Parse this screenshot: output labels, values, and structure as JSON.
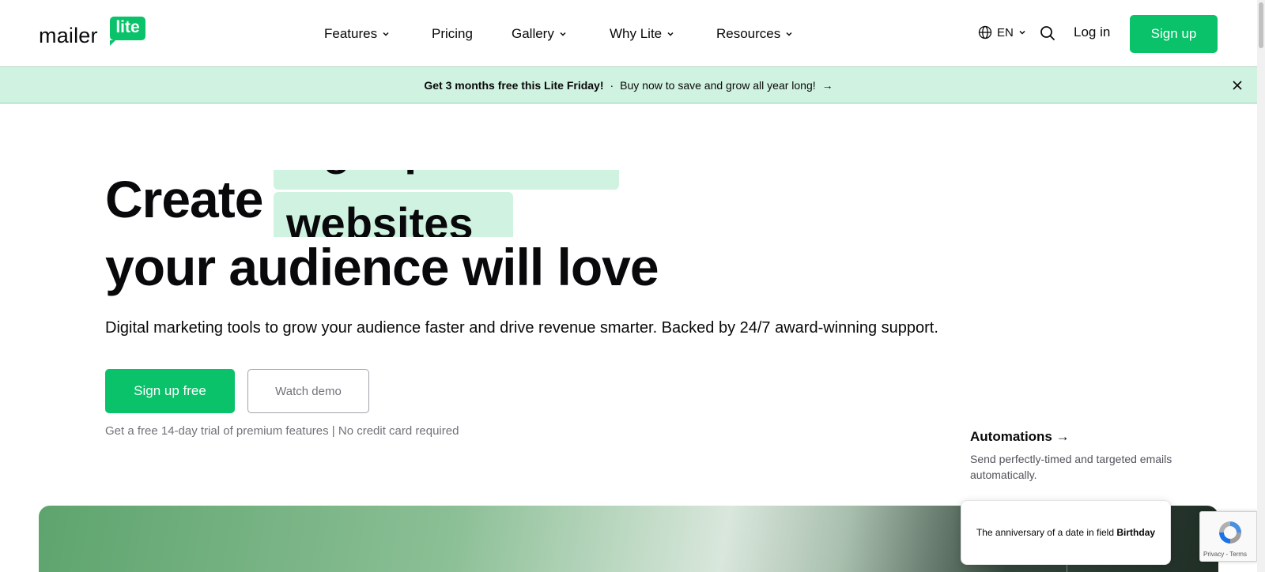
{
  "header": {
    "logo_text": "mailer",
    "logo_badge": "lite",
    "nav": [
      {
        "label": "Features",
        "has_dropdown": true
      },
      {
        "label": "Pricing",
        "has_dropdown": false
      },
      {
        "label": "Gallery",
        "has_dropdown": true
      },
      {
        "label": "Why Lite",
        "has_dropdown": true
      },
      {
        "label": "Resources",
        "has_dropdown": true
      }
    ],
    "language": "EN",
    "login_label": "Log in",
    "signup_label": "Sign up"
  },
  "promo": {
    "bold_text": "Get 3 months free this Lite Friday!",
    "separator": "·",
    "text": "Buy now to save and grow all year long!",
    "arrow": "→"
  },
  "hero": {
    "title_start": "Create",
    "rotating_words": [
      "signup forms",
      "websites"
    ],
    "title_end": "your audience will love",
    "subtitle": "Digital marketing tools to grow your audience faster and drive revenue smarter. Backed by 24/7 award-winning support.",
    "primary_cta": "Sign up free",
    "secondary_cta": "Watch demo",
    "note": "Get a free 14-day trial of premium features | No credit card required"
  },
  "feature": {
    "title": "Automations →",
    "description": "Send perfectly-timed and targeted emails automatically."
  },
  "tooltip_card": {
    "text": "The anniversary of a date in field",
    "bold": "Birthday"
  },
  "recaptcha": {
    "links": "Privacy - Terms"
  },
  "colors": {
    "brand_green": "#09c269",
    "promo_bg": "#d0f2e1",
    "text_dark": "#09090b"
  }
}
